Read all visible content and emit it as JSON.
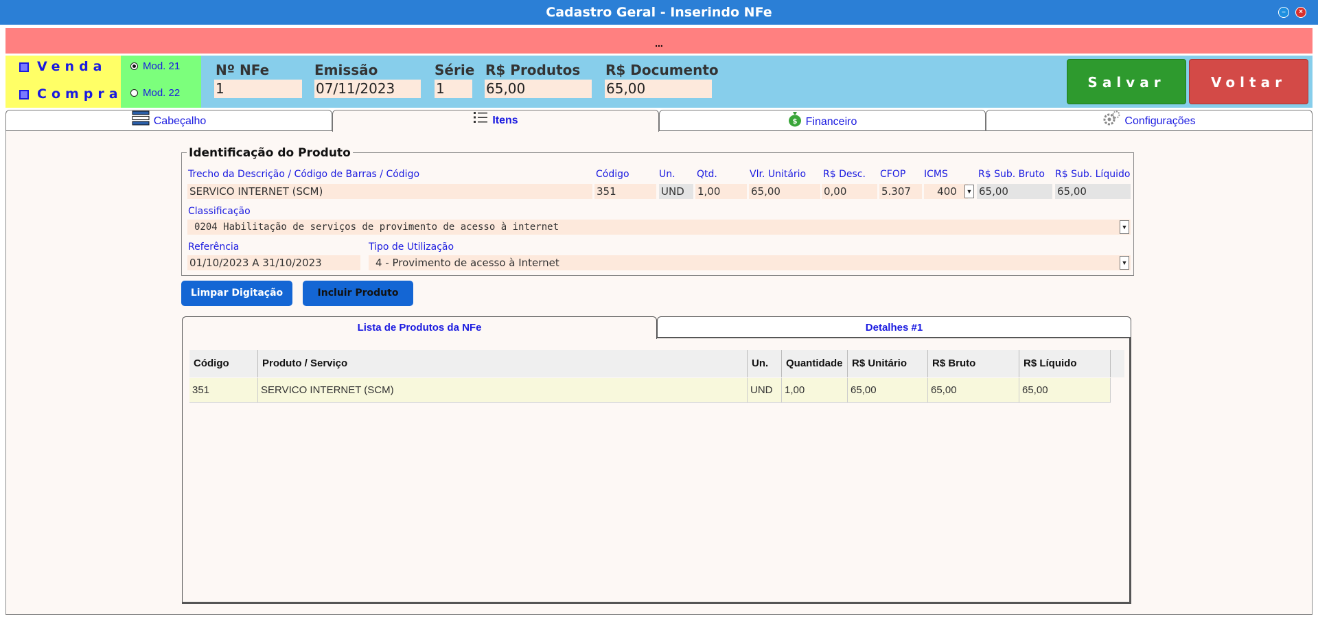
{
  "window": {
    "title": "Cadastro Geral - Inserindo NFe",
    "minimize_icon": "minimize-icon",
    "close_icon": "close-icon"
  },
  "alert": {
    "text": "..."
  },
  "header": {
    "type_sale": "Venda",
    "type_purchase": "Compra",
    "models": [
      {
        "label": "Mod. 21",
        "selected": true
      },
      {
        "label": "Mod. 22",
        "selected": false
      }
    ],
    "fields": {
      "nfe_number_label": "Nº NFe",
      "nfe_number_value": "1",
      "issue_label": "Emissão",
      "issue_value": "07/11/2023",
      "series_label": "Série",
      "series_value": "1",
      "products_label": "R$ Produtos",
      "products_value": "65,00",
      "document_label": "R$ Documento",
      "document_value": "65,00"
    },
    "save_label": "Salvar",
    "back_label": "Voltar"
  },
  "tabs": [
    {
      "label": "Cabeçalho",
      "icon": "list-stack-icon"
    },
    {
      "label": "Itens",
      "icon": "list-icon",
      "active": true
    },
    {
      "label": "Financeiro",
      "icon": "money-bag-icon"
    },
    {
      "label": "Configurações",
      "icon": "gear-icon"
    }
  ],
  "product": {
    "legend": "Identificação do Produto",
    "labels": {
      "description": "Trecho da Descrição / Código de Barras / Código",
      "code": "Código",
      "unit": "Un.",
      "qty": "Qtd.",
      "unit_price": "Vlr. Unitário",
      "discount": "R$ Desc.",
      "cfop": "CFOP",
      "icms": "ICMS",
      "sub_gross": "R$ Sub. Bruto",
      "sub_net": "R$ Sub. Líquido",
      "classification": "Classificação",
      "reference": "Referência",
      "usage_type": "Tipo de Utilização"
    },
    "values": {
      "description": "SERVICO INTERNET (SCM)",
      "code": "351",
      "unit": "UND",
      "qty": "1,00",
      "unit_price": "65,00",
      "discount": "0,00",
      "cfop": "5.307",
      "icms": "400",
      "sub_gross": "65,00",
      "sub_net": "65,00",
      "classification": "0204 Habilitação de serviços de provimento de acesso à internet",
      "reference": "01/10/2023 A 31/10/2023",
      "usage_type": "4 - Provimento de acesso à Internet"
    },
    "clear_label": "Limpar Digitação",
    "include_label": "Incluir Produto"
  },
  "items_tabs": [
    {
      "label": "Lista de Produtos da NFe",
      "active": true
    },
    {
      "label": "Detalhes #1"
    }
  ],
  "table": {
    "columns": [
      "Código",
      "Produto / Serviço",
      "Un.",
      "Quantidade",
      "R$ Unitário",
      "R$ Bruto",
      "R$ Líquido"
    ],
    "rows": [
      [
        "351",
        "SERVICO INTERNET (SCM)",
        "UND",
        "1,00",
        "65,00",
        "65,00",
        "65,00"
      ]
    ]
  }
}
